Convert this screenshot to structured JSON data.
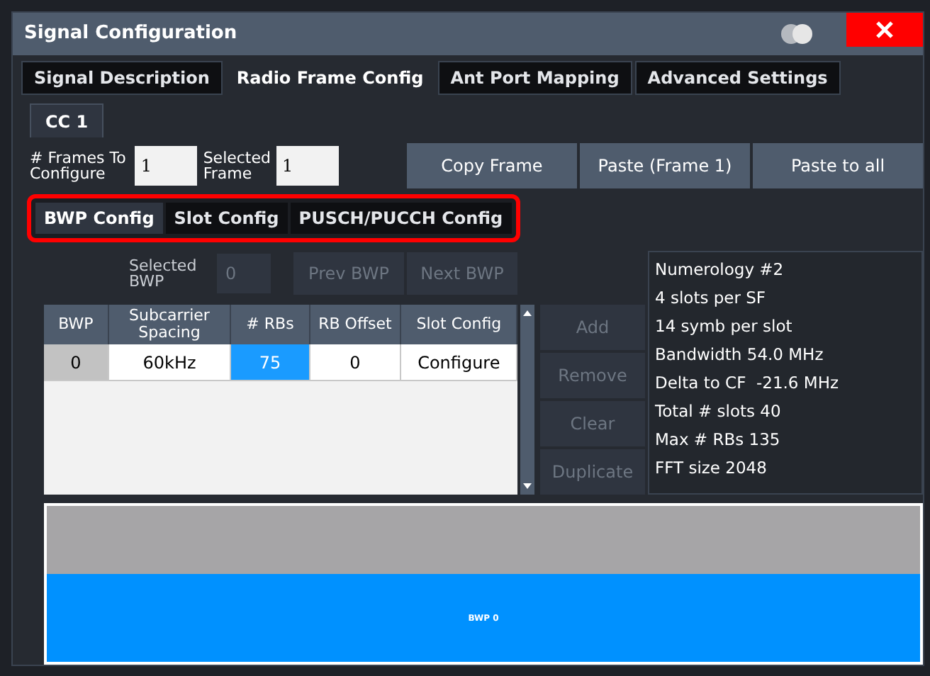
{
  "window": {
    "title": "Signal Configuration",
    "toggle_on": false
  },
  "tabs": [
    {
      "label": "Signal Description",
      "selected": false
    },
    {
      "label": "Radio Frame Config",
      "selected": true
    },
    {
      "label": "Ant Port Mapping",
      "selected": false
    },
    {
      "label": "Advanced Settings",
      "selected": false
    }
  ],
  "carrier_tabs": [
    {
      "label": "CC 1",
      "selected": true
    }
  ],
  "frames": {
    "frames_label": "# Frames To Configure",
    "frames_value": "1",
    "selected_label": "Selected Frame",
    "selected_value": "1"
  },
  "frame_buttons": [
    {
      "label": "Copy Frame",
      "disabled": false
    },
    {
      "label": "Paste (Frame 1)",
      "disabled": false
    },
    {
      "label": "Paste to all",
      "disabled": false
    }
  ],
  "sub_tabs": [
    {
      "label": "BWP Config",
      "selected": true
    },
    {
      "label": "Slot Config",
      "selected": false
    },
    {
      "label": "PUSCH/PUCCH Config",
      "selected": false
    }
  ],
  "bwp_selector": {
    "label": "Selected BWP",
    "value": "0",
    "buttons": [
      {
        "label": "Prev BWP",
        "disabled": true
      },
      {
        "label": "Next BWP",
        "disabled": true
      }
    ]
  },
  "table": {
    "columns": [
      "BWP",
      "Subcarrier Spacing",
      "# RBs",
      "RB Offset",
      "Slot Config"
    ],
    "rows": [
      {
        "cells": [
          {
            "text": "0",
            "selected": false
          },
          {
            "text": "60kHz",
            "selected": false
          },
          {
            "text": "75",
            "selected": true
          },
          {
            "text": "0",
            "selected": false
          },
          {
            "text": "Configure",
            "selected": false
          }
        ]
      }
    ]
  },
  "side_buttons": [
    {
      "label": "Add",
      "disabled": true
    },
    {
      "label": "Remove",
      "disabled": true
    },
    {
      "label": "Clear",
      "disabled": true
    },
    {
      "label": "Duplicate",
      "disabled": true
    }
  ],
  "info": [
    "Numerology #2",
    "4 slots per SF",
    "14 symb per slot",
    "Bandwidth 54.0 MHz",
    "Delta to CF  -21.6 MHz",
    "Total # slots 40",
    "Max # RBs 135",
    "FFT size 2048"
  ],
  "bwp_map": [
    {
      "label": "BWP 0",
      "color": "#0091ff"
    }
  ]
}
